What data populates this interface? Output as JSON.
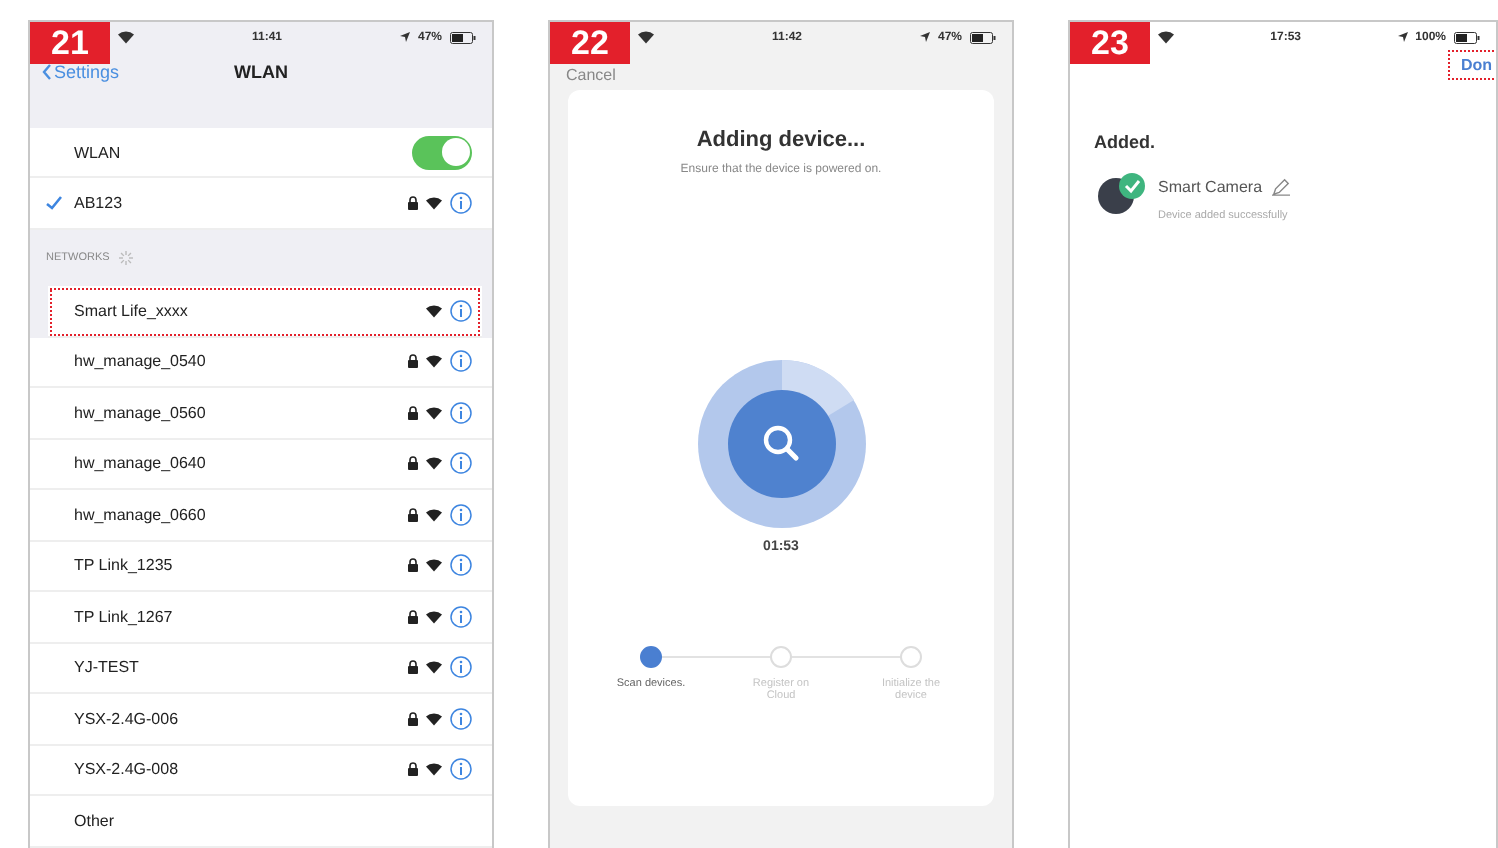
{
  "panels": [
    {
      "kind": "wlan",
      "badge": "21",
      "status_bar": {
        "time": "11:41",
        "battery": "47%"
      },
      "nav": {
        "back": "Settings",
        "title": "WLAN"
      },
      "wlan_toggle": {
        "label": "WLAN",
        "on": true
      },
      "current_network": {
        "name": "AB123",
        "checked": true
      },
      "section_header": "NETWORKS",
      "networks": [
        {
          "name": "Smart Life_xxxx",
          "locked": false,
          "highlighted": true
        },
        {
          "name": "hw_manage_0540",
          "locked": true,
          "highlighted": false
        },
        {
          "name": "hw_manage_0560",
          "locked": true,
          "highlighted": false
        },
        {
          "name": "hw_manage_0640",
          "locked": true,
          "highlighted": false
        },
        {
          "name": "hw_manage_0660",
          "locked": true,
          "highlighted": false
        },
        {
          "name": "TP Link_1235",
          "locked": true,
          "highlighted": false
        },
        {
          "name": "TP Link_1267",
          "locked": true,
          "highlighted": false
        },
        {
          "name": "YJ-TEST",
          "locked": true,
          "highlighted": false
        },
        {
          "name": "YSX-2.4G-006",
          "locked": true,
          "highlighted": false
        },
        {
          "name": "YSX-2.4G-008",
          "locked": true,
          "highlighted": false
        }
      ],
      "other": "Other"
    },
    {
      "kind": "adding",
      "badge": "22",
      "status_bar": {
        "time": "11:42",
        "battery": "47%"
      },
      "cancel": "Cancel",
      "title": "Adding device...",
      "subtitle": "Ensure that the device is powered on.",
      "timer": "01:53",
      "steps": [
        {
          "label": "Scan devices.",
          "selected": true
        },
        {
          "label": "Register on Cloud",
          "selected": false
        },
        {
          "label": "Initialize the device",
          "selected": false
        }
      ]
    },
    {
      "kind": "added",
      "badge": "23",
      "status_bar": {
        "time": "17:53",
        "battery": "100%"
      },
      "done": "Don",
      "heading": "Added.",
      "device": {
        "name": "Smart Camera",
        "status": "Device added successfully"
      }
    }
  ]
}
